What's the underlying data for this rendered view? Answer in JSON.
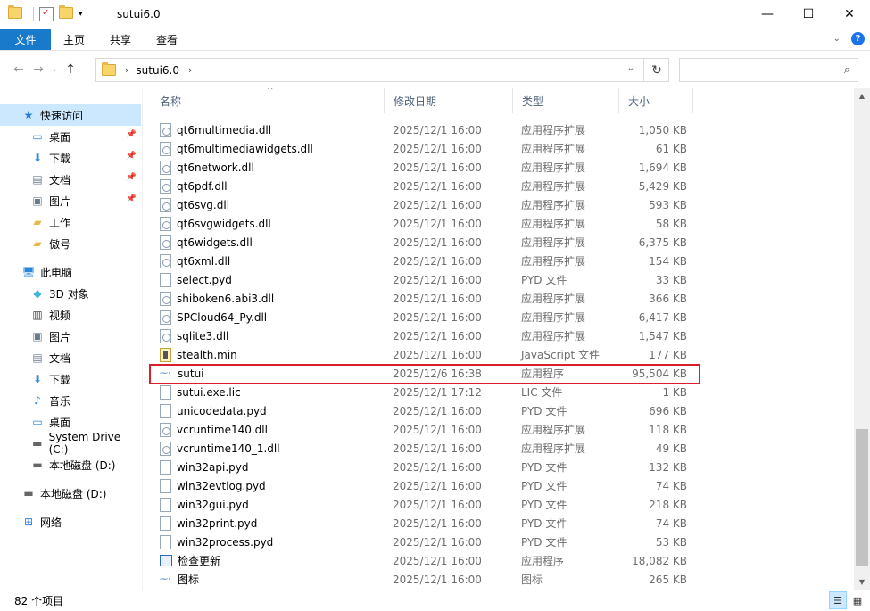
{
  "window": {
    "title": "sutui6.0"
  },
  "ribbon": {
    "tabs": [
      "文件",
      "主页",
      "共享",
      "查看"
    ]
  },
  "address": {
    "crumb": "sutui6.0"
  },
  "search": {
    "placeholder": ""
  },
  "nav": {
    "items": [
      {
        "label": "快速访问",
        "icon": "star-icon",
        "selected": true,
        "pinned": false
      },
      {
        "label": "桌面",
        "icon": "desktop-icon",
        "pinned": true
      },
      {
        "label": "下载",
        "icon": "download-icon",
        "pinned": true
      },
      {
        "label": "文档",
        "icon": "document-icon",
        "pinned": true
      },
      {
        "label": "图片",
        "icon": "picture-icon",
        "pinned": true
      },
      {
        "label": "工作",
        "icon": "folder-icon",
        "pinned": false
      },
      {
        "label": "傲号",
        "icon": "folder-icon",
        "pinned": false
      },
      {
        "label": "此电脑",
        "icon": "computer-icon",
        "pinned": false
      },
      {
        "label": "3D 对象",
        "icon": "cube-icon",
        "pinned": false
      },
      {
        "label": "视频",
        "icon": "video-icon",
        "pinned": false
      },
      {
        "label": "图片",
        "icon": "picture-icon",
        "pinned": false
      },
      {
        "label": "文档",
        "icon": "document-icon",
        "pinned": false
      },
      {
        "label": "下载",
        "icon": "download-icon",
        "pinned": false
      },
      {
        "label": "音乐",
        "icon": "music-icon",
        "pinned": false
      },
      {
        "label": "桌面",
        "icon": "desktop-icon",
        "pinned": false
      },
      {
        "label": "System Drive (C:)",
        "icon": "drive-icon",
        "pinned": false
      },
      {
        "label": "本地磁盘 (D:)",
        "icon": "drive-icon",
        "pinned": false
      },
      {
        "label": "本地磁盘 (D:)",
        "icon": "drive-icon",
        "pinned": false
      },
      {
        "label": "网络",
        "icon": "network-icon",
        "pinned": false
      }
    ]
  },
  "columns": {
    "name": "名称",
    "date": "修改日期",
    "type": "类型",
    "size": "大小"
  },
  "files": [
    {
      "name": "qt6multimedia.dll",
      "date": "2025/12/1 16:00",
      "type": "应用程序扩展",
      "size": "1,050 KB",
      "kind": "dll"
    },
    {
      "name": "qt6multimediawidgets.dll",
      "date": "2025/12/1 16:00",
      "type": "应用程序扩展",
      "size": "61 KB",
      "kind": "dll"
    },
    {
      "name": "qt6network.dll",
      "date": "2025/12/1 16:00",
      "type": "应用程序扩展",
      "size": "1,694 KB",
      "kind": "dll"
    },
    {
      "name": "qt6pdf.dll",
      "date": "2025/12/1 16:00",
      "type": "应用程序扩展",
      "size": "5,429 KB",
      "kind": "dll"
    },
    {
      "name": "qt6svg.dll",
      "date": "2025/12/1 16:00",
      "type": "应用程序扩展",
      "size": "593 KB",
      "kind": "dll"
    },
    {
      "name": "qt6svgwidgets.dll",
      "date": "2025/12/1 16:00",
      "type": "应用程序扩展",
      "size": "58 KB",
      "kind": "dll"
    },
    {
      "name": "qt6widgets.dll",
      "date": "2025/12/1 16:00",
      "type": "应用程序扩展",
      "size": "6,375 KB",
      "kind": "dll"
    },
    {
      "name": "qt6xml.dll",
      "date": "2025/12/1 16:00",
      "type": "应用程序扩展",
      "size": "154 KB",
      "kind": "dll"
    },
    {
      "name": "select.pyd",
      "date": "2025/12/1 16:00",
      "type": "PYD 文件",
      "size": "33 KB",
      "kind": "file"
    },
    {
      "name": "shiboken6.abi3.dll",
      "date": "2025/12/1 16:00",
      "type": "应用程序扩展",
      "size": "366 KB",
      "kind": "dll"
    },
    {
      "name": "SPCloud64_Py.dll",
      "date": "2025/12/1 16:00",
      "type": "应用程序扩展",
      "size": "6,417 KB",
      "kind": "dll"
    },
    {
      "name": "sqlite3.dll",
      "date": "2025/12/1 16:00",
      "type": "应用程序扩展",
      "size": "1,547 KB",
      "kind": "dll"
    },
    {
      "name": "stealth.min",
      "date": "2025/12/1 16:00",
      "type": "JavaScript 文件",
      "size": "177 KB",
      "kind": "js"
    },
    {
      "name": "sutui",
      "date": "2025/12/6 16:38",
      "type": "应用程序",
      "size": "95,504 KB",
      "kind": "exe"
    },
    {
      "name": "sutui.exe.lic",
      "date": "2025/12/1 17:12",
      "type": "LIC 文件",
      "size": "1 KB",
      "kind": "file"
    },
    {
      "name": "unicodedata.pyd",
      "date": "2025/12/1 16:00",
      "type": "PYD 文件",
      "size": "696 KB",
      "kind": "file"
    },
    {
      "name": "vcruntime140.dll",
      "date": "2025/12/1 16:00",
      "type": "应用程序扩展",
      "size": "118 KB",
      "kind": "dll"
    },
    {
      "name": "vcruntime140_1.dll",
      "date": "2025/12/1 16:00",
      "type": "应用程序扩展",
      "size": "49 KB",
      "kind": "dll"
    },
    {
      "name": "win32api.pyd",
      "date": "2025/12/1 16:00",
      "type": "PYD 文件",
      "size": "132 KB",
      "kind": "file"
    },
    {
      "name": "win32evtlog.pyd",
      "date": "2025/12/1 16:00",
      "type": "PYD 文件",
      "size": "74 KB",
      "kind": "file"
    },
    {
      "name": "win32gui.pyd",
      "date": "2025/12/1 16:00",
      "type": "PYD 文件",
      "size": "218 KB",
      "kind": "file"
    },
    {
      "name": "win32print.pyd",
      "date": "2025/12/1 16:00",
      "type": "PYD 文件",
      "size": "74 KB",
      "kind": "file"
    },
    {
      "name": "win32process.pyd",
      "date": "2025/12/1 16:00",
      "type": "PYD 文件",
      "size": "53 KB",
      "kind": "file"
    },
    {
      "name": "检查更新",
      "date": "2025/12/1 16:00",
      "type": "应用程序",
      "size": "18,082 KB",
      "kind": "app"
    },
    {
      "name": "图标",
      "date": "2025/12/1 16:00",
      "type": "图标",
      "size": "265 KB",
      "kind": "exe"
    }
  ],
  "status": {
    "count": "82 个项目"
  }
}
